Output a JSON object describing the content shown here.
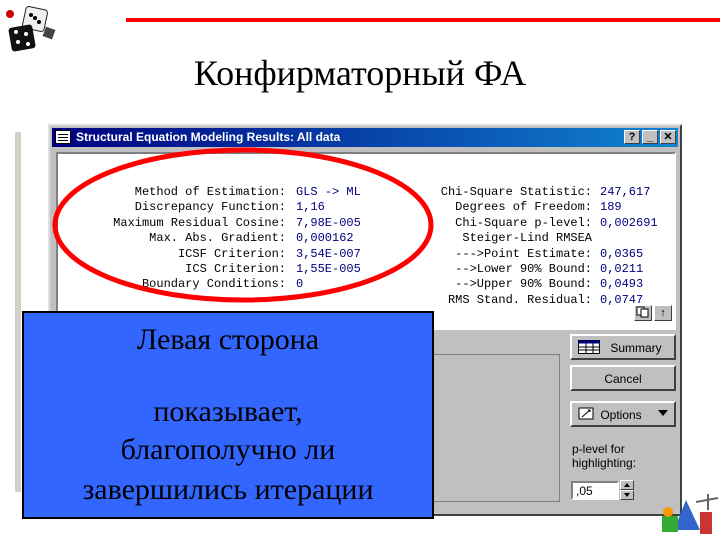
{
  "slide": {
    "title": "Конфирматорный ФА"
  },
  "window": {
    "title": "Structural Equation Modeling Results: All data",
    "buttons": {
      "help": "?",
      "minimize": "_",
      "close": "✕"
    }
  },
  "results": {
    "left": [
      {
        "label": "Method of Estimation:",
        "value": "GLS -> ML"
      },
      {
        "label": "Discrepancy Function:",
        "value": "1,16"
      },
      {
        "label": "Maximum Residual Cosine:",
        "value": "7,98E-005"
      },
      {
        "label": "Max. Abs. Gradient:",
        "value": "0,000162"
      },
      {
        "label": "ICSF Criterion:",
        "value": "3,54E-007"
      },
      {
        "label": "ICS Criterion:",
        "value": "1,55E-005"
      },
      {
        "label": "Boundary Conditions:",
        "value": "0"
      }
    ],
    "right": [
      {
        "label": "Chi-Square Statistic:",
        "value": "247,617"
      },
      {
        "label": "Degrees of Freedom:",
        "value": "189"
      },
      {
        "label": "Chi-Square p-level:",
        "value": "0,002691"
      },
      {
        "label": "Steiger-Lind RMSEA",
        "value": ""
      },
      {
        "label": "--->Point Estimate:",
        "value": "0,0365"
      },
      {
        "label": "-->Lower 90% Bound:",
        "value": "0,0211"
      },
      {
        "label": "-->Upper 90% Bound:",
        "value": "0,0493"
      },
      {
        "label": "RMS Stand. Residual:",
        "value": "0,0747"
      }
    ]
  },
  "buttons": {
    "summary": "Summary",
    "cancel": "Cancel",
    "options": "Options"
  },
  "plevel": {
    "label_line1": "p-level for",
    "label_line2": "highlighting:",
    "value": ",05"
  },
  "callout": {
    "line1": "Левая сторона",
    "line2": "показывает,",
    "line3": "благополучно ли",
    "line4": "завершились итерации"
  },
  "colors": {
    "highlight_ellipse": "#ff0000",
    "callout_bg": "#3366ff",
    "title_bar": "#000080",
    "accent_line": "#ff0000"
  }
}
